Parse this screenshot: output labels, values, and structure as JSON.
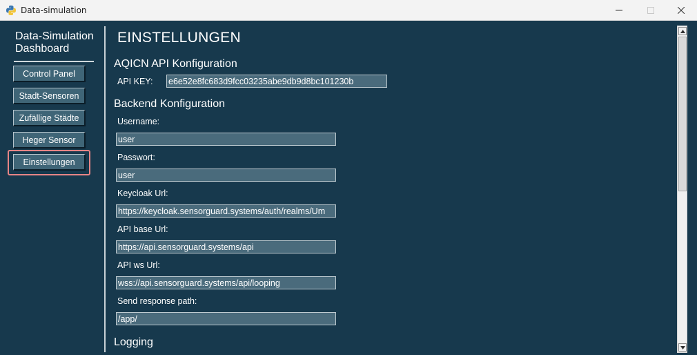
{
  "window": {
    "title": "Data-simulation",
    "icon": "python-icon",
    "controls": [
      "minimize",
      "maximize",
      "close"
    ]
  },
  "sidebar": {
    "brand": "Data-Simulation Dashboard",
    "items": [
      {
        "label": "Control Panel"
      },
      {
        "label": "Stadt-Sensoren"
      },
      {
        "label": "Zufällige Städte"
      },
      {
        "label": "Heger Sensor"
      },
      {
        "label": "Einstellungen",
        "active": true
      }
    ],
    "highlight_color": "#e88586"
  },
  "main": {
    "title": "EINSTELLUNGEN",
    "aqicn": {
      "heading": "AQICN API Konfiguration",
      "api_key_label": "API KEY:",
      "api_key_value": "e6e52e8fc683d9fcc03235abe9db9d8bc101230b"
    },
    "backend": {
      "heading": "Backend Konfiguration",
      "username_label": "Username:",
      "username_value": "user",
      "password_label": "Passwort:",
      "password_value": "user",
      "keycloak_label": "Keycloak Url:",
      "keycloak_value": "https://keycloak.sensorguard.systems/auth/realms/Um",
      "api_base_label": "API base Url:",
      "api_base_value": "https://api.sensorguard.systems/api",
      "api_ws_label": "API ws Url:",
      "api_ws_value": "wss://api.sensorguard.systems/api/looping",
      "response_path_label": "Send response path:",
      "response_path_value": "/app/"
    },
    "logging": {
      "heading": "Logging"
    }
  },
  "colors": {
    "background": "#17394d",
    "input_background": "#4a6b7c",
    "button_background": "#3f6577"
  }
}
